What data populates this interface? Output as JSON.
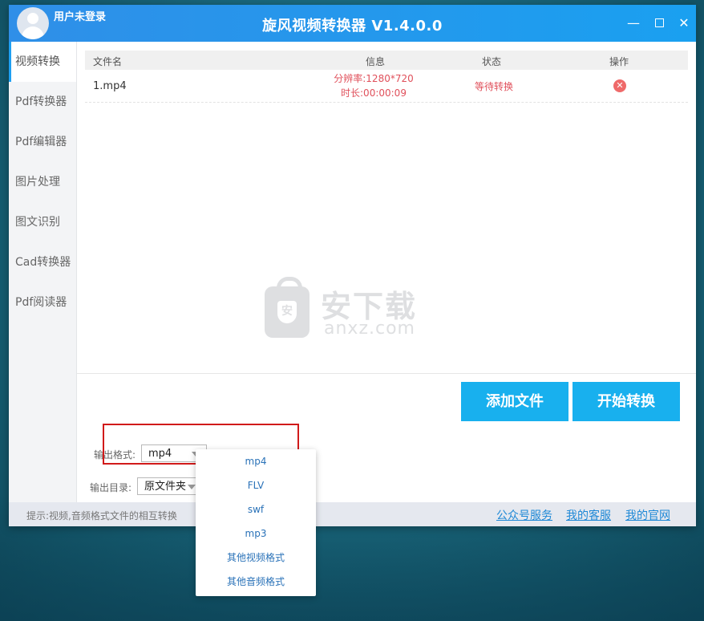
{
  "window": {
    "title": "旋风视频转换器 V1.4.0.0",
    "user": "用户未登录"
  },
  "sidebar": {
    "items": [
      {
        "label": "视频转换",
        "active": true
      },
      {
        "label": "Pdf转换器"
      },
      {
        "label": "Pdf编辑器"
      },
      {
        "label": "图片处理"
      },
      {
        "label": "图文识别"
      },
      {
        "label": "Cad转换器"
      },
      {
        "label": "Pdf阅读器"
      }
    ]
  },
  "table": {
    "headers": {
      "name": "文件名",
      "info": "信息",
      "status": "状态",
      "action": "操作"
    },
    "rows": [
      {
        "name": "1.mp4",
        "resolution": "分辨率:1280*720",
        "duration": "时长:00:00:09",
        "status": "等待转换"
      }
    ]
  },
  "watermark": {
    "brand_cn": "安下载",
    "brand_en": "anxz.com",
    "shield": "安"
  },
  "buttons": {
    "add": "添加文件",
    "start": "开始转换"
  },
  "output": {
    "format_label": "输出格式:",
    "format_value": "mp4",
    "dir_label": "输出目录:",
    "dir_value": "原文件夹"
  },
  "dropdown": {
    "options": [
      "mp4",
      "FLV",
      "swf",
      "mp3",
      "其他视频格式",
      "其他音频格式"
    ]
  },
  "statusbar": {
    "hint": "提示:视频,音频格式文件的相互转换",
    "links": [
      "公众号服务",
      "我的客服",
      "我的官网"
    ]
  },
  "colors": {
    "accent": "#18b0ee",
    "titlebar": "#1aa0f0",
    "warning": "#e0505b",
    "highlight": "#d11a1a"
  }
}
